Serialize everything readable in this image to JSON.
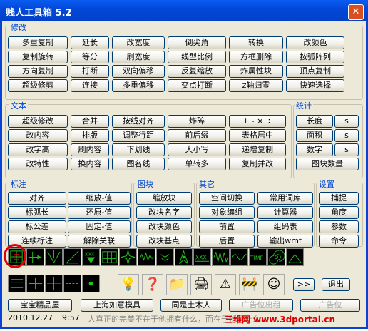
{
  "window": {
    "title": "贱人工具箱  5.2",
    "close": "✕"
  },
  "groups": {
    "modify": "修改",
    "text": "文本",
    "stats": "统计",
    "annot": "标注",
    "block": "图块",
    "other": "其它",
    "settings": "设置"
  },
  "modify_buttons": [
    "多重复制",
    "延长",
    "改宽度",
    "倒尖角",
    "转换",
    "改颜色",
    "复制旋转",
    "等分",
    "刷宽度",
    "线型比例",
    "方框删除",
    "按弧阵列",
    "方向复制",
    "打断",
    "双向偏移",
    "反复缩放",
    "炸属性块",
    "顶点复制",
    "超级修剪",
    "连接",
    "多重偏移",
    "交点打断",
    "z轴归零",
    "快速选择"
  ],
  "text_buttons": [
    "超级修改",
    "合并",
    "按线对齐",
    "炸碎",
    "+ - × ÷",
    "改内容",
    "排版",
    "调整行距",
    "前后缀",
    "表格居中",
    "改字高",
    "刷内容",
    "下划线",
    "大小写",
    "递增复制",
    "改特性",
    "换内容",
    "图名线",
    "单转多",
    "复制并改"
  ],
  "stats_buttons": [
    "长度",
    "s",
    "面积",
    "s",
    "数字",
    "s",
    "图块数量"
  ],
  "annot_buttons": [
    "对齐",
    "缩放-值",
    "标弧长",
    "还原-值",
    "标公差",
    "固定-值",
    "连续标注",
    "解除关联"
  ],
  "block_buttons": [
    "缩放块",
    "改块名字",
    "改块颜色",
    "改块基点"
  ],
  "other_buttons": [
    "空间切换",
    "常用词库",
    "对象编组",
    "计算器",
    "前置",
    "组码表",
    "后置",
    "输出wmf"
  ],
  "settings_buttons": [
    "捕捉",
    "角度",
    "参数",
    "命令"
  ],
  "icon_row1": [
    "grid-square-icon",
    "arrow-line-icon",
    "angle-arrow-icon",
    "diagonal-line-icon",
    "xxx-arrow-icon",
    "table-grid-icon",
    "star-burst-icon",
    "dimension-wave-icon",
    "tree-icon",
    "compass-icon",
    "xxx-text-icon",
    "spring-icon",
    "wave-icon",
    "time-text-icon",
    "spiral-icon",
    "arrow-right-icon"
  ],
  "icon_row2": [
    "hatch-lines-icon",
    "horizontal-line-icon",
    "cross-icon",
    "dashed-line-icon",
    "dot-icon"
  ],
  "icon_row2_right": [
    "lightbulb-icon",
    "help-icon",
    "folder-icon",
    "printer-icon",
    "warning-icon",
    "worker-sign-icon",
    "cartoon-face-icon"
  ],
  "time_label": "TIME",
  "xxx_label": "XXX",
  "more_label": ">>",
  "exit_label": "退出",
  "bottom_buttons": [
    "宝宝精品屋",
    "上海如意模具",
    "同是土木人",
    "广告位出租",
    "广告位"
  ],
  "status": {
    "date": "2010.12.27",
    "time": "9:57",
    "motto": "人真正的完美不在于他拥有什么，而在于他是什么。"
  },
  "watermark": "三维网 www.3dportal.cn",
  "colors": {
    "title_blue": "#0348d8",
    "group_label": "#0046d5",
    "highlight_ring": "#e00000",
    "icon_green": "#22c020"
  }
}
